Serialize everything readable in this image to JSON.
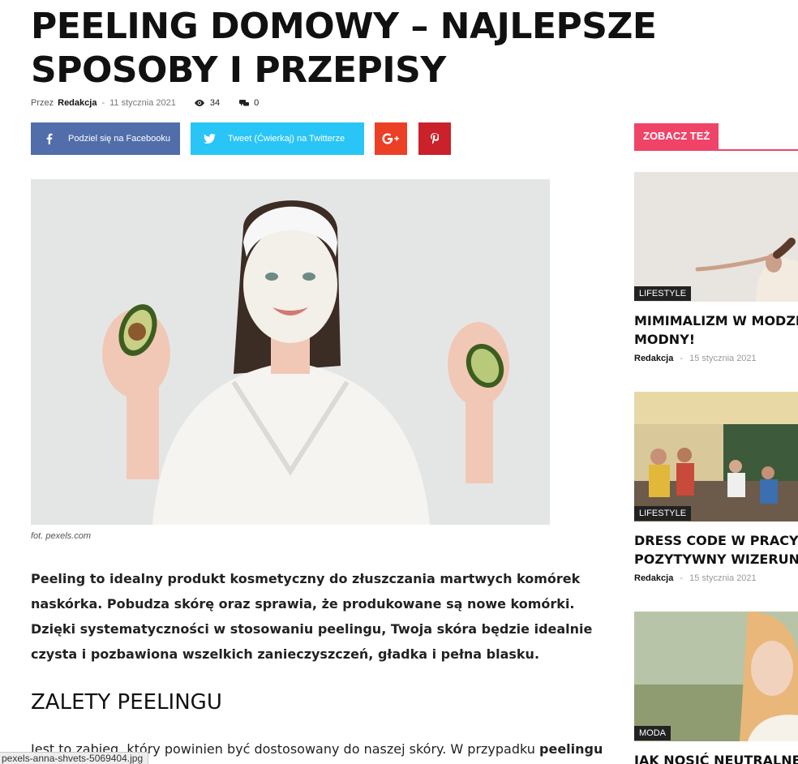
{
  "article": {
    "title": "PEELING DOMOWY – NAJLEPSZE SPOSOBY I PRZEPISY",
    "by_label": "Przez",
    "author": "Redakcja",
    "separator": "-",
    "date": "11 stycznia 2021",
    "views": "34",
    "comments": "0"
  },
  "share": {
    "facebook_label": "Podziel się na Facebooku",
    "twitter_label": "Tweet (Ćwierkaj) na Twitterze"
  },
  "image": {
    "caption": "fot. pexels.com"
  },
  "content": {
    "lead": "Peeling to idealny produkt kosmetyczny do złuszczania martwych komórek naskórka. Pobudza skórę oraz sprawia, że produkowane są nowe komórki. Dzięki systematyczności w stosowaniu peelingu, Twoja skóra będzie idealnie czysta i pozbawiona wszelkich zanieczyszczeń, gładka i pełna blasku.",
    "heading": "ZALETY PEELINGU",
    "paragraph_start": "Jest to zabieg, który powinien być dostosowany do naszej skóry. W przypadku ",
    "paragraph_bold": "peelingu"
  },
  "status_bar": {
    "text": "pexels-anna-shvets-5069404.jpg"
  },
  "sidebar": {
    "heading": "ZOBACZ TEŻ",
    "accent": "#ef4468",
    "cards": [
      {
        "category": "LIFESTYLE",
        "title_line1": "MIMIMALIZM W MODZIE",
        "title_line2": "MODNY!",
        "author": "Redakcja",
        "separator": "-",
        "date": "15 stycznia 2021"
      },
      {
        "category": "LIFESTYLE",
        "title_line1": "DRESS CODE W PRACY – Z",
        "title_line2": "POZYTYWNY WIZERUNEK",
        "author": "Redakcja",
        "separator": "-",
        "date": "15 stycznia 2021"
      },
      {
        "category": "MODA",
        "title_line1": "JAK NOSIĆ NEUTRALNE K",
        "title_line2": "",
        "author": "",
        "separator": "",
        "date": ""
      }
    ]
  },
  "colors": {
    "facebook": "#516eab",
    "twitter": "#29c5f6",
    "googleplus": "#eb4026",
    "pinterest": "#ca212a"
  },
  "icons": [
    "eye-icon",
    "comment-icon",
    "facebook-icon",
    "twitter-icon",
    "google-plus-icon",
    "pinterest-icon"
  ]
}
